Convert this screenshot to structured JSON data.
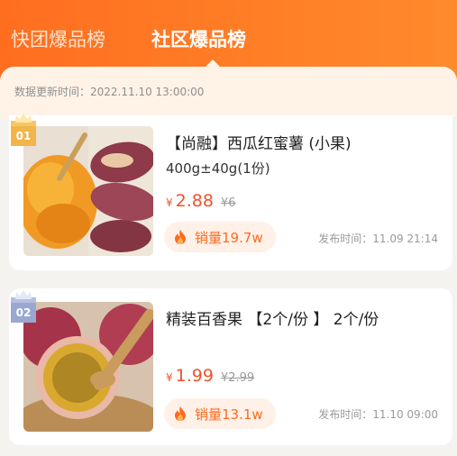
{
  "tabs": [
    {
      "label": "快团爆品榜",
      "active": false
    },
    {
      "label": "社区爆品榜",
      "active": true
    }
  ],
  "update_notice": "数据更新时间：2022.11.10 13:00:00",
  "colors": {
    "accent": "#ff7a27",
    "price": "#f1522b",
    "sales": "#ff6a1f"
  },
  "products": [
    {
      "rank": "01",
      "rank_badge_color": "#f2b54a",
      "title": "【尚融】西瓜红蜜薯  (小果)",
      "subtitle": "400g±40g(1份)",
      "currency": "¥",
      "price": "2.88",
      "original_price": "¥6",
      "sales": "销量19.7w",
      "publish_time": "发布时间：11.09 21:14",
      "image": "sweet-potato-photo"
    },
    {
      "rank": "02",
      "rank_badge_color": "#a8b4d8",
      "title": "精装百香果 【2个/份 】 2个/份",
      "subtitle": "",
      "currency": "¥",
      "price": "1.99",
      "original_price": "¥2.99",
      "sales": "销量13.1w",
      "publish_time": "发布时间：11.10 09:00",
      "image": "passion-fruit-photo"
    }
  ]
}
